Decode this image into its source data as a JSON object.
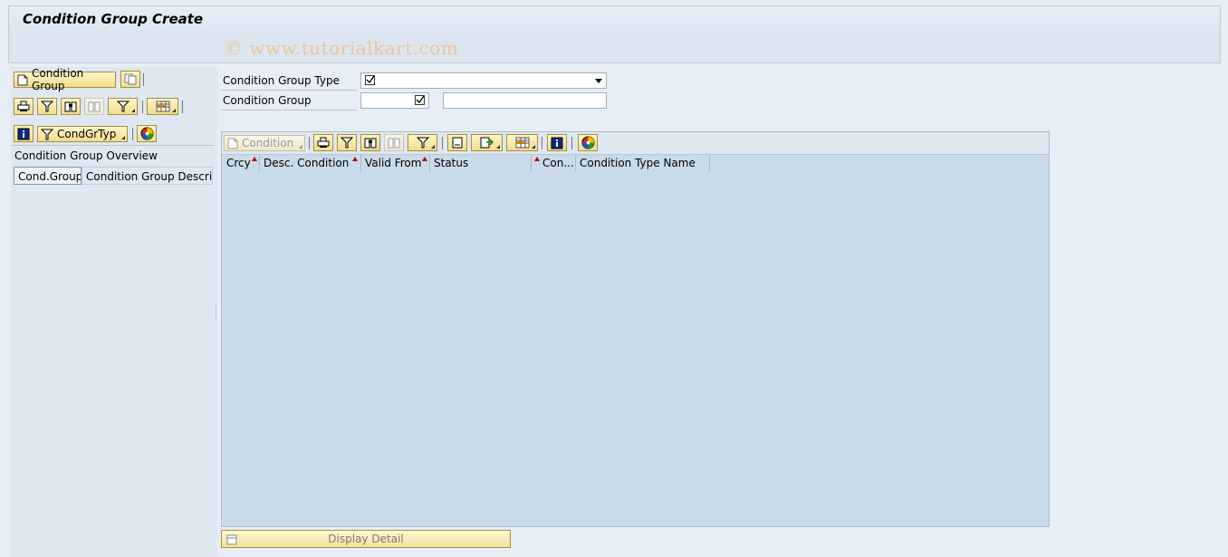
{
  "title": "Condition Group Create",
  "watermark": "© www.tutorialkart.com",
  "left_pane": {
    "condition_group_button": "Condition Group",
    "condgrtyp_button": "CondGrTyp",
    "overview_title": "Condition Group Overview",
    "columns": [
      "Cond.Group",
      "Condition Group Descrip..."
    ]
  },
  "form": {
    "group_type_label": "Condition Group Type",
    "group_type_value": "",
    "group_label": "Condition Group",
    "group_value": "",
    "group_description": ""
  },
  "grid": {
    "condition_button": "Condition",
    "columns": [
      "Crcy",
      "Desc. Condition",
      "Valid From",
      "Status",
      "Con...",
      "Condition Type Name"
    ],
    "rows": []
  },
  "display_detail_button": "Display Detail",
  "icons": [
    "new-document-icon",
    "copy-icon",
    "print-icon",
    "filter-icon",
    "find-icon",
    "find-next-icon",
    "set-filter-icon",
    "layout-icon",
    "info-icon",
    "color-wheel-icon",
    "checkbox-icon",
    "dropdown-arrow-icon"
  ],
  "colors": {
    "background": "#e8eef5",
    "grid_area": "#c9dae8",
    "button": "#f2dc8c",
    "sort_marker": "#c00000",
    "watermark": "#f0c39a"
  }
}
